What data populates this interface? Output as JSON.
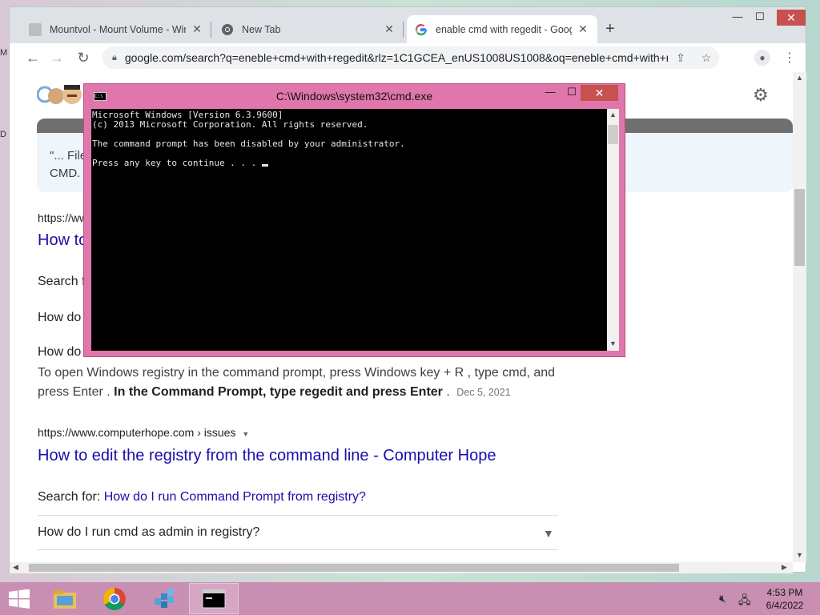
{
  "desktop": {
    "edge_glyphs": [
      "M",
      "D"
    ]
  },
  "browser": {
    "tabs": [
      {
        "title": "Mountvol - Mount Volume - Win",
        "icon": "doc-icon"
      },
      {
        "title": "New Tab",
        "icon": "chrome-icon"
      },
      {
        "title": "enable cmd with regedit - Googl",
        "icon": "google-icon"
      }
    ],
    "new_tab_label": "+",
    "window_controls": {
      "minimize": "—",
      "maximize": "☐",
      "close": "✕"
    },
    "url": "google.com/search?q=eneble+cmd+with+regedit&rlz=1C1GCEA_enUS1008US1008&oq=eneble+cmd+with+r..."
  },
  "page": {
    "card_text_line1": "\"... File",
    "card_text_line2": "CMD.",
    "result1": {
      "url": "https://ww",
      "title": "How to",
      "search_prefix": "Search f",
      "faq1": "How do",
      "faq2": "How do"
    },
    "snippet": {
      "plain": "To open Windows registry in the command prompt, press Windows key + R , type cmd, and press Enter .",
      "bold": "In the Command Prompt, type regedit and press Enter",
      "period": ".",
      "date": "Dec 5, 2021"
    },
    "result2": {
      "url": "https://www.computerhope.com › issues",
      "title": "How to edit the registry from the command line - Computer Hope",
      "search_label": "Search for:",
      "search_link": "How do I run Command Prompt from registry?",
      "faq": "How do I run cmd as admin in registry?"
    }
  },
  "cmd": {
    "title": "C:\\Windows\\system32\\cmd.exe",
    "icon_text": "C:\\",
    "lines": [
      "Microsoft Windows [Version 6.3.9600]",
      "(c) 2013 Microsoft Corporation. All rights reserved.",
      "",
      "The command prompt has been disabled by your administrator.",
      "",
      "Press any key to continue . . . "
    ]
  },
  "taskbar": {
    "items": [
      "file-explorer-icon",
      "chrome-icon",
      "registry-editor-icon",
      "cmd-icon"
    ],
    "time": "4:53 PM",
    "date": "6/4/2022"
  },
  "colors": {
    "cmd_frame": "#e077ac",
    "taskbar": "#c98fb2",
    "link": "#1a0dab",
    "close_red": "#c75050"
  }
}
